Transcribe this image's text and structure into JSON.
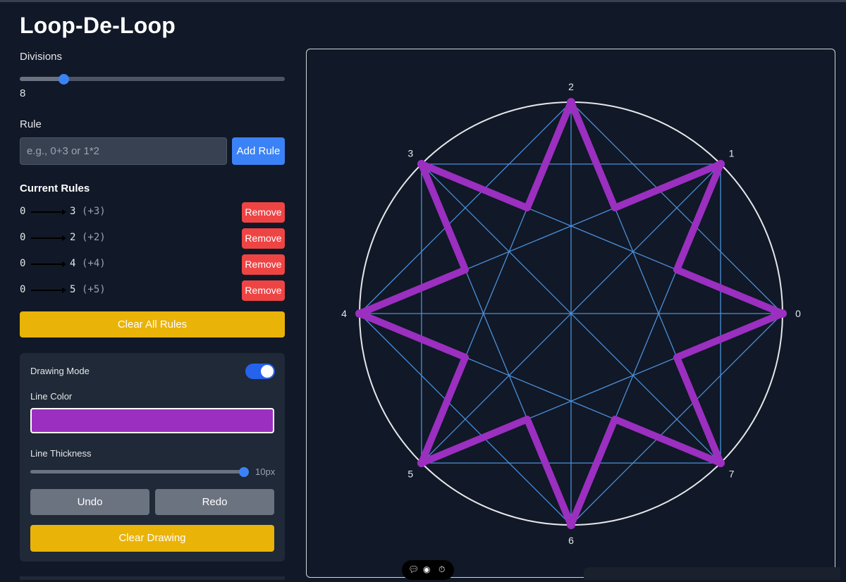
{
  "app": {
    "title": "Loop-De-Loop"
  },
  "divisions": {
    "label": "Divisions",
    "value": "8",
    "fraction": 0.17
  },
  "rule": {
    "label": "Rule",
    "placeholder": "e.g., 0+3 or 1*2",
    "add_label": "Add Rule"
  },
  "rules": {
    "heading": "Current Rules",
    "items": [
      {
        "from": "0",
        "to": "3",
        "delta": "(+3)",
        "remove": "Remove"
      },
      {
        "from": "0",
        "to": "2",
        "delta": "(+2)",
        "remove": "Remove"
      },
      {
        "from": "0",
        "to": "4",
        "delta": "(+4)",
        "remove": "Remove"
      },
      {
        "from": "0",
        "to": "5",
        "delta": "(+5)",
        "remove": "Remove"
      }
    ],
    "clear_label": "Clear All Rules"
  },
  "drawing": {
    "mode_label": "Drawing Mode",
    "mode_on": true,
    "color_label": "Line Color",
    "color_value": "#9b2fc0",
    "thickness_label": "Line Thickness",
    "thickness_value": "10px",
    "thickness_fraction": 1.0,
    "undo_label": "Undo",
    "redo_label": "Redo",
    "clear_label": "Clear Drawing"
  },
  "canvas": {
    "point_labels": [
      "0",
      "1",
      "2",
      "3",
      "4",
      "5",
      "6",
      "7"
    ],
    "chord_color": "#4a90d9",
    "circle_color": "#e5e7eb",
    "path_color": "#9b2fc0"
  },
  "toolbar": {
    "icons": [
      "comment-icon",
      "eye-icon",
      "timer-icon"
    ]
  },
  "colors": {
    "accent_blue": "#3b82f6",
    "remove_red": "#ef4444",
    "clear_yellow": "#eab308",
    "neutral_gray": "#6b7280"
  }
}
